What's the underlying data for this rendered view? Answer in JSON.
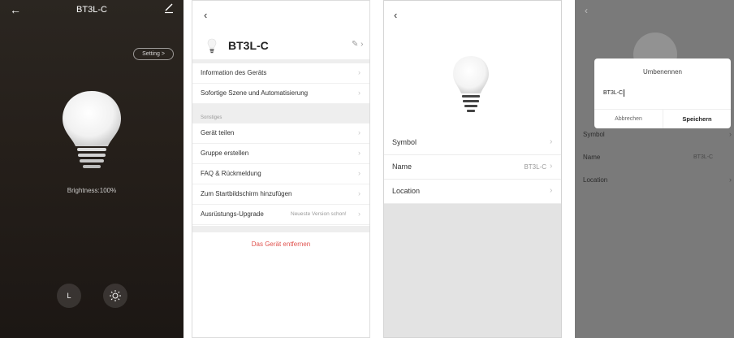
{
  "panel1": {
    "title": "BT3L-C",
    "setting_label": "Setting >",
    "brightness_label": "Brightness:100%",
    "timer_label": "L",
    "accent": "#2b2621"
  },
  "panel2": {
    "device_name": "BT3L-C",
    "section_label": "Sonstiges",
    "items": [
      {
        "label": "Information des Geräts"
      },
      {
        "label": "Sofortige Szene und Automatisierung"
      },
      {
        "label": "Gerät teilen"
      },
      {
        "label": "Gruppe erstellen"
      },
      {
        "label": "FAQ & Rückmeldung"
      },
      {
        "label": "Zum Startbildschirm hinzufügen"
      },
      {
        "label": "Ausrüstungs-Upgrade",
        "value": "Neueste Version schon!"
      }
    ],
    "remove_label": "Das Gerät entfernen",
    "danger_color": "#e0524e"
  },
  "panel3": {
    "items": [
      {
        "label": "Symbol",
        "value": ""
      },
      {
        "label": "Name",
        "value": "BT3L-C"
      },
      {
        "label": "Location",
        "value": ""
      }
    ]
  },
  "panel4": {
    "items": [
      {
        "label": "Symbol",
        "value": ""
      },
      {
        "label": "Name",
        "value": "BT3L-C"
      },
      {
        "label": "Location",
        "value": ""
      }
    ],
    "dialog": {
      "title": "Umbenennen",
      "input_value": "BT3L-C",
      "cancel_label": "Abbrechen",
      "save_label": "Speichern"
    }
  }
}
